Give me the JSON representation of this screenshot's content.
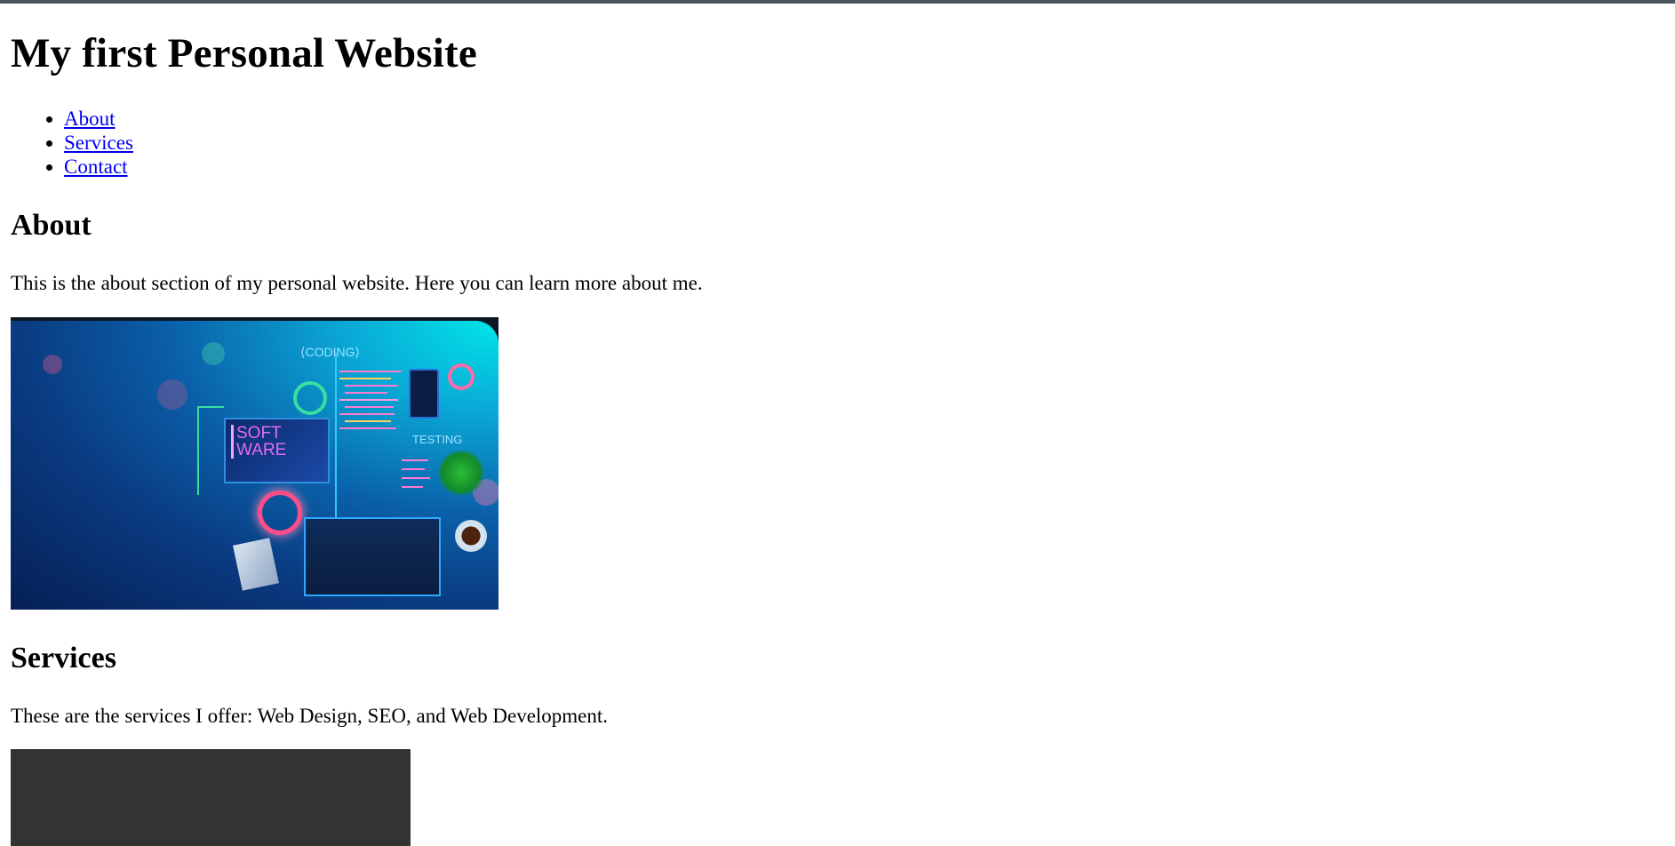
{
  "page": {
    "title": "My first Personal Website"
  },
  "nav": {
    "items": [
      {
        "label": "About"
      },
      {
        "label": "Services"
      },
      {
        "label": "Contact"
      }
    ]
  },
  "about": {
    "heading": "About",
    "text": "This is the about section of my personal website. Here you can learn more about me.",
    "image": {
      "labels": {
        "coding": "⟨CODING⟩",
        "software_line1": "SOFT",
        "software_line2": "WARE",
        "testing": "TESTING"
      }
    }
  },
  "services": {
    "heading": "Services",
    "text": "These are the services I offer: Web Design, SEO, and Web Development."
  },
  "colors": {
    "link": "#0000ee",
    "top_strip": "#4a5560",
    "dark_image": "#333333"
  }
}
